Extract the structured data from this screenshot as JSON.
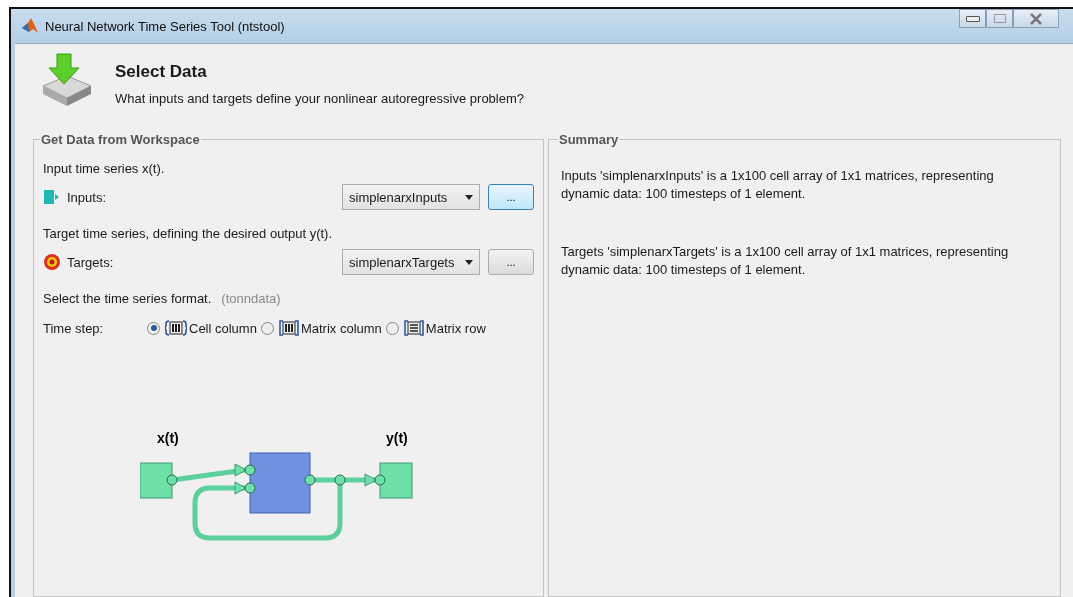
{
  "window": {
    "title": "Neural Network Time Series Tool (ntstool)"
  },
  "header": {
    "title": "Select Data",
    "subtitle": "What inputs and targets define your nonlinear autoregressive problem?"
  },
  "workspace_panel": {
    "title": "Get Data from Workspace",
    "inputs": {
      "description": "Input time series x(t).",
      "label": "Inputs:",
      "value": "simplenarxInputs",
      "browse": "...",
      "browse_focused": true
    },
    "targets": {
      "description": "Target time series, defining the desired output y(t).",
      "label": "Targets:",
      "value": "simplenarxTargets",
      "browse": "...",
      "browse_focused": false
    },
    "format_hint": "Select the time series format.",
    "format_name": "(tonndata)",
    "time_step_label": "Time step:",
    "formats": [
      {
        "kind": "cell",
        "label": "Cell column",
        "selected": true
      },
      {
        "kind": "matrix-column",
        "label": "Matrix column",
        "selected": false
      },
      {
        "kind": "matrix-row",
        "label": "Matrix row",
        "selected": false
      }
    ],
    "diagram": {
      "input_label": "x(t)",
      "output_label": "y(t)"
    }
  },
  "summary_panel": {
    "title": "Summary",
    "lines": [
      "Inputs 'simplenarxInputs' is a 1x100 cell array of 1x1 matrices, representing dynamic data: 100 timesteps of 1 element.",
      "Targets 'simplenarxTargets' is a 1x100 cell array of 1x1 matrices, representing dynamic data: 100 timesteps of 1 element."
    ]
  }
}
